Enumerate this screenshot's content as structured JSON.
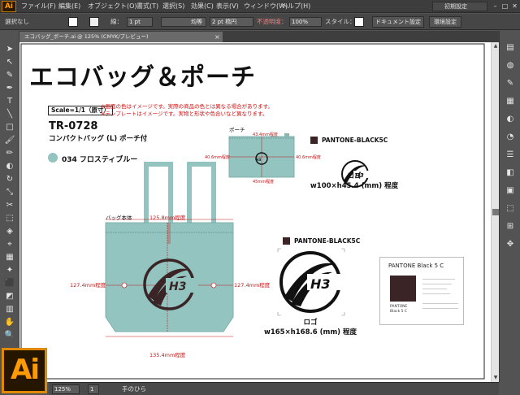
{
  "menubar": {
    "app_icon": "Ai",
    "items": [
      "ファイル(F)",
      "編集(E)",
      "オブジェクト(O)",
      "書式(T)",
      "選択(S)",
      "効果(C)",
      "表示(V)",
      "ウィンドウ(W)",
      "ヘルプ(H)"
    ],
    "workspace": "初期設定",
    "window_buttons": [
      "–",
      "□",
      "✕"
    ]
  },
  "controlbar": {
    "selection_label": "選択なし",
    "stroke_label": "線：",
    "stroke_weight": "1 pt",
    "stroke_profile": "均等",
    "brush": "2 pt 楕円",
    "opacity_label": "不透明度：",
    "opacity_value": "100%",
    "style_label": "スタイル：",
    "doc_setup_button": "ドキュメント設定",
    "prefs_button": "環境設定"
  },
  "document_tab": {
    "title": "エコバッグ_ポーチ.ai @ 125% (CMYK/プレビュー)",
    "close": "×"
  },
  "tools": [
    "➤",
    "↖",
    "✎",
    "✒",
    "T",
    "╲",
    "□",
    "🖌",
    "✏",
    "◐",
    "↻",
    "⤡",
    "✂",
    "⬚",
    "◈",
    "⌖",
    "▦",
    "✦",
    "⬛",
    "◩",
    "▥",
    "✋",
    "🔍"
  ],
  "right_icons": [
    "▤",
    "◍",
    "✎",
    "▦",
    "◐",
    "◔",
    "☰",
    "◧",
    "▣",
    "⬚",
    "⊞",
    "✥"
  ],
  "statusbar": {
    "zoom": "125%",
    "page": "1",
    "tool_name": "手のひら"
  },
  "artboard": {
    "title": "エコバッグ＆ポーチ",
    "scale": "Scale=1/1（原寸）",
    "notes": [
      "※画面の色はイメージです。実際の商品の色とは異なる場合があります。",
      "※テンプレートはイメージです。実物と形状や色合いなど異なります。"
    ],
    "product_code": "TR-0728",
    "product_name": "コンパクトバッグ (L) ポーチ付",
    "color_name": "034 フロスティブルー",
    "pouch_label": "ポーチ",
    "pouch_width": "43.4mm程度",
    "pouch_left": "40.6mm程度",
    "pouch_right": "40.6mm程度",
    "pouch_bottom": "45mm程度",
    "bag_label": "バッグ本体",
    "bag_top_width": "125.8mm程度",
    "bag_left": "127.4mm程度",
    "bag_right": "127.4mm程度",
    "bag_bottom_width": "135.4mm程度",
    "pantone_small": "PANTONE-BLACK5C",
    "logo_small_caption_1": "ロゴ",
    "logo_small_caption_2": "w100×h45.4 (mm) 程度",
    "pantone_large": "PANTONE-BLACK5C",
    "logo_large_caption_1": "ロゴ",
    "logo_large_caption_2": "w165×h168.6 (mm) 程度",
    "logo_text": "H3",
    "pantone_card_title": "PANTONE Black 5 C",
    "pantone_card_brand": "PANTONE",
    "pantone_card_code": "Black 5 C"
  },
  "colors": {
    "bag": "#93c4c0",
    "bag_stroke": "#7fb0ac",
    "pantone": "#3a2426",
    "dim": "#c01818"
  }
}
